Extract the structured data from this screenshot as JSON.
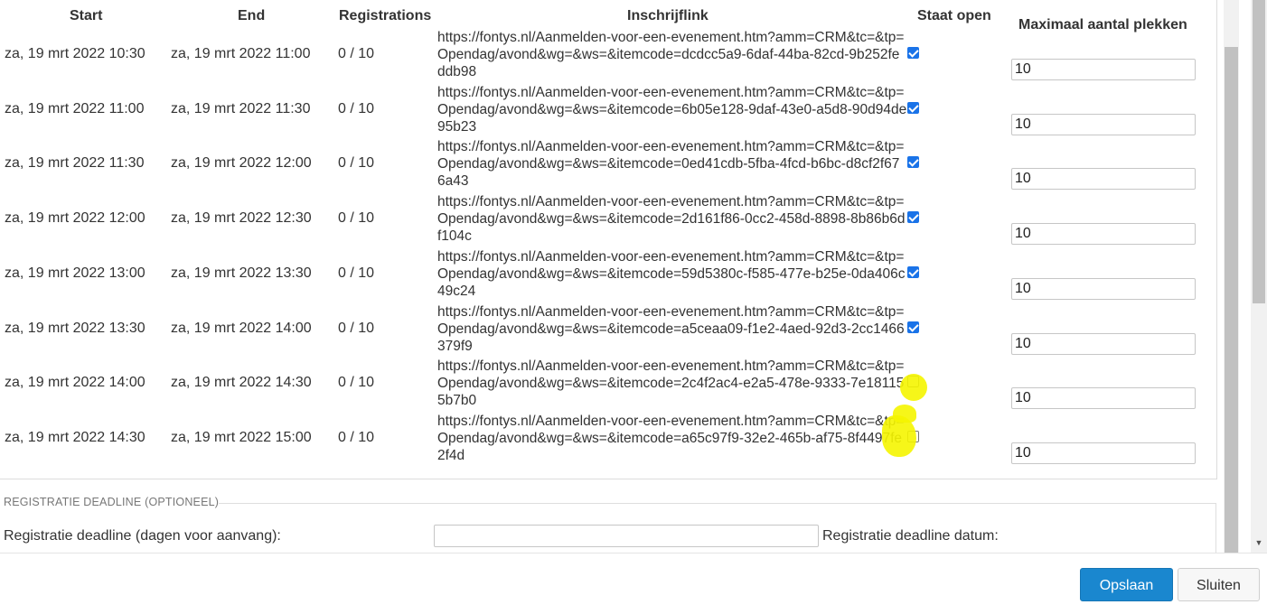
{
  "table": {
    "headers": {
      "start": "Start",
      "end": "End",
      "registrations": "Registrations",
      "link": "Inschrijflink",
      "open": "Staat open",
      "max": "Maximaal aantal plekken"
    },
    "rows": [
      {
        "start": "za, 19 mrt 2022 10:30",
        "end": "za, 19 mrt 2022 11:00",
        "registrations": "0 / 10",
        "link": "https://fontys.nl/Aanmelden-voor-een-evenement.htm?amm=CRM&tc=&tp=Opendag/avond&wg=&ws=&itemcode=dcdcc5a9-6daf-44ba-82cd-9b252feddb98",
        "open": true,
        "max": "10"
      },
      {
        "start": "za, 19 mrt 2022 11:00",
        "end": "za, 19 mrt 2022 11:30",
        "registrations": "0 / 10",
        "link": "https://fontys.nl/Aanmelden-voor-een-evenement.htm?amm=CRM&tc=&tp=Opendag/avond&wg=&ws=&itemcode=6b05e128-9daf-43e0-a5d8-90d94de95b23",
        "open": true,
        "max": "10"
      },
      {
        "start": "za, 19 mrt 2022 11:30",
        "end": "za, 19 mrt 2022 12:00",
        "registrations": "0 / 10",
        "link": "https://fontys.nl/Aanmelden-voor-een-evenement.htm?amm=CRM&tc=&tp=Opendag/avond&wg=&ws=&itemcode=0ed41cdb-5fba-4fcd-b6bc-d8cf2f676a43",
        "open": true,
        "max": "10"
      },
      {
        "start": "za, 19 mrt 2022 12:00",
        "end": "za, 19 mrt 2022 12:30",
        "registrations": "0 / 10",
        "link": "https://fontys.nl/Aanmelden-voor-een-evenement.htm?amm=CRM&tc=&tp=Opendag/avond&wg=&ws=&itemcode=2d161f86-0cc2-458d-8898-8b86b6df104c",
        "open": true,
        "max": "10"
      },
      {
        "start": "za, 19 mrt 2022 13:00",
        "end": "za, 19 mrt 2022 13:30",
        "registrations": "0 / 10",
        "link": "https://fontys.nl/Aanmelden-voor-een-evenement.htm?amm=CRM&tc=&tp=Opendag/avond&wg=&ws=&itemcode=59d5380c-f585-477e-b25e-0da406c49c24",
        "open": true,
        "max": "10"
      },
      {
        "start": "za, 19 mrt 2022 13:30",
        "end": "za, 19 mrt 2022 14:00",
        "registrations": "0 / 10",
        "link": "https://fontys.nl/Aanmelden-voor-een-evenement.htm?amm=CRM&tc=&tp=Opendag/avond&wg=&ws=&itemcode=a5ceaa09-f1e2-4aed-92d3-2cc1466379f9",
        "open": true,
        "max": "10"
      },
      {
        "start": "za, 19 mrt 2022 14:00",
        "end": "za, 19 mrt 2022 14:30",
        "registrations": "0 / 10",
        "link": "https://fontys.nl/Aanmelden-voor-een-evenement.htm?amm=CRM&tc=&tp=Opendag/avond&wg=&ws=&itemcode=2c4f2ac4-e2a5-478e-9333-7e181155b7b0",
        "open": false,
        "max": "10"
      },
      {
        "start": "za, 19 mrt 2022 14:30",
        "end": "za, 19 mrt 2022 15:00",
        "registrations": "0 / 10",
        "link": "https://fontys.nl/Aanmelden-voor-een-evenement.htm?amm=CRM&tc=&tp=Opendag/avond&wg=&ws=&itemcode=a65c97f9-32e2-465b-af75-8f4497fe2f4d",
        "open": false,
        "max": "10"
      }
    ]
  },
  "deadline": {
    "section_title": "REGISTRATIE DEADLINE (OPTIONEEL)",
    "days_label": "Registratie deadline (dagen voor aanvang):",
    "days_value": "",
    "date_label": "Registratie deadline datum:"
  },
  "footer": {
    "save_label": "Opslaan",
    "close_label": "Sluiten"
  },
  "colors": {
    "primary": "#1a87cf",
    "checkbox": "#1a73e8",
    "highlight": "#f5f500"
  }
}
